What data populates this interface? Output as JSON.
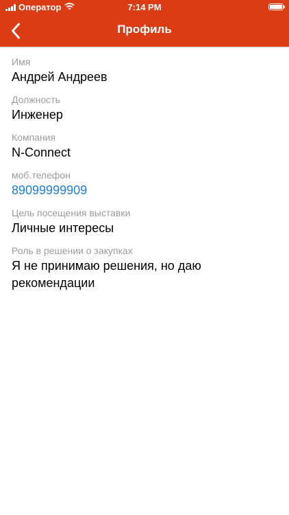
{
  "status_bar": {
    "carrier": "Оператор",
    "time": "7:14 PM"
  },
  "nav": {
    "title": "Профиль",
    "back_icon": "chevron-left-icon"
  },
  "colors": {
    "header": "#dc3c14",
    "label": "#9b9b9b",
    "value": "#000000",
    "link": "#1a7fd8"
  },
  "profile": {
    "name": {
      "label": "Имя",
      "value": "Андрей Андреев"
    },
    "position": {
      "label": "Должность",
      "value": "Инженер"
    },
    "company": {
      "label": "Компания",
      "value": "N-Connect"
    },
    "phone": {
      "label": "моб.телефон",
      "value": "89099999909"
    },
    "visit_goal": {
      "label": "Цель посещения выставки",
      "value": "Личные интересы"
    },
    "purchase_role": {
      "label": "Роль в решении о закупках",
      "value": "Я не принимаю решения, но даю рекомендации"
    }
  }
}
